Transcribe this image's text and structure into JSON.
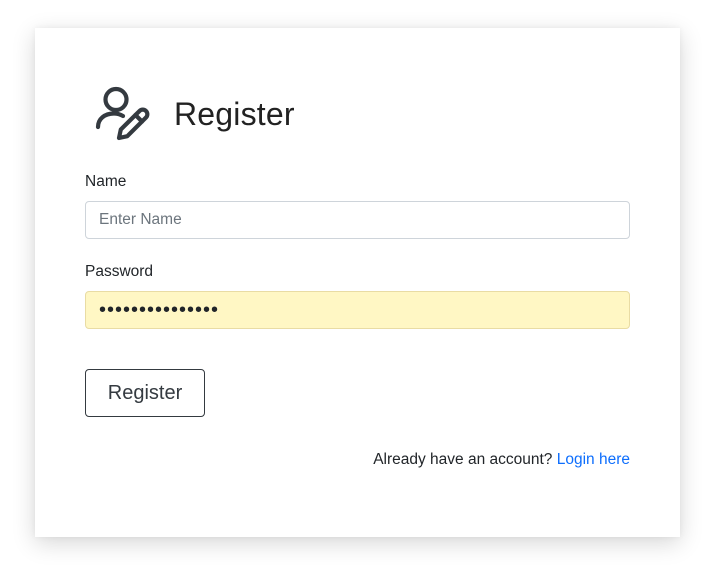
{
  "form": {
    "icon": "user-edit-icon",
    "title": "Register",
    "name_label": "Name",
    "name_placeholder": "Enter Name",
    "name_value": "",
    "password_label": "Password",
    "password_value": "•••••••••••••••",
    "password_autofill_bg": "#fff7c4",
    "submit_label": "Register",
    "footer_text": "Already have an account?",
    "login_link_text": "Login here",
    "link_color": "#0d6efd"
  }
}
